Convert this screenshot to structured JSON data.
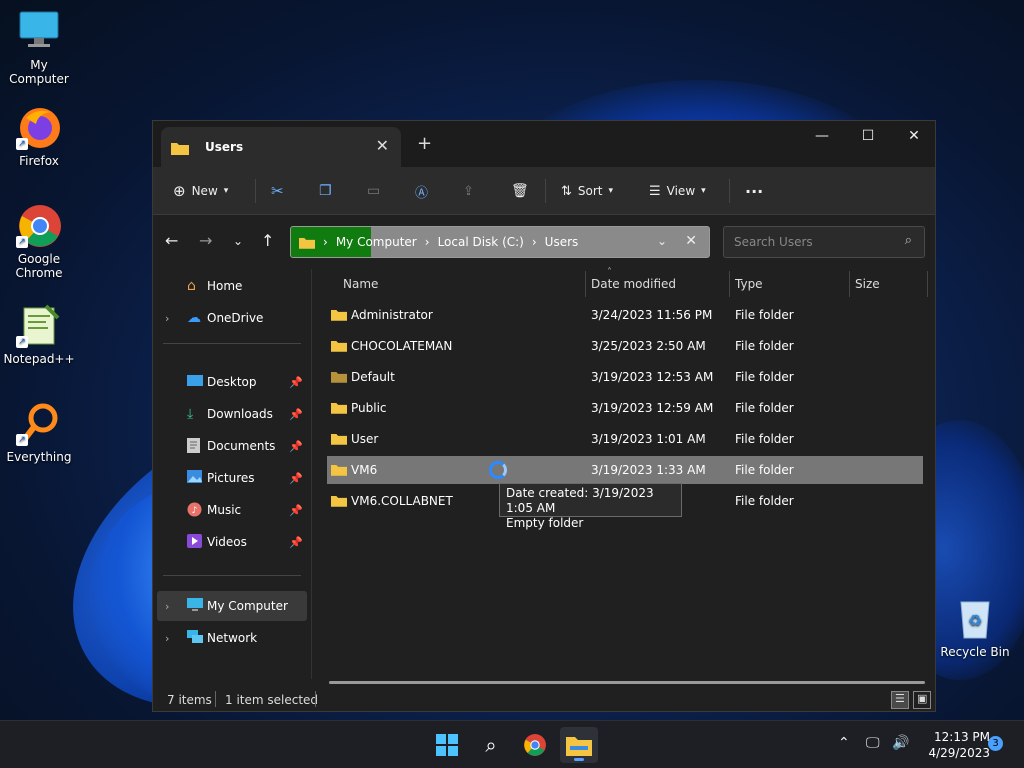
{
  "desktop": {
    "icons": [
      {
        "label": "My Computer",
        "icon": "monitor-icon"
      },
      {
        "label": "Firefox",
        "icon": "firefox-icon"
      },
      {
        "label": "Google Chrome",
        "icon": "chrome-icon"
      },
      {
        "label": "Notepad++",
        "icon": "notepadpp-icon"
      },
      {
        "label": "Everything",
        "icon": "everything-search-icon"
      }
    ],
    "recycle_bin": "Recycle Bin"
  },
  "window": {
    "tab_title": "Users",
    "toolbar": {
      "new_label": "New",
      "sort_label": "Sort",
      "view_label": "View",
      "more_label": "···"
    },
    "address": {
      "crumbs": [
        "My Computer",
        "Local Disk (C:)",
        "Users"
      ]
    },
    "search": {
      "placeholder": "Search Users"
    },
    "sidebar": {
      "home": "Home",
      "onedrive": "OneDrive",
      "quick": [
        "Desktop",
        "Downloads",
        "Documents",
        "Pictures",
        "Music",
        "Videos"
      ],
      "computer": "My Computer",
      "network": "Network"
    },
    "columns": {
      "name": "Name",
      "date": "Date modified",
      "type": "Type",
      "size": "Size"
    },
    "rows": [
      {
        "name": "Administrator",
        "date": "3/24/2023 11:56 PM",
        "type": "File folder"
      },
      {
        "name": "CHOCOLATEMAN",
        "date": "3/25/2023 2:50 AM",
        "type": "File folder"
      },
      {
        "name": "Default",
        "date": "3/19/2023 12:53 AM",
        "type": "File folder"
      },
      {
        "name": "Public",
        "date": "3/19/2023 12:59 AM",
        "type": "File folder"
      },
      {
        "name": "User",
        "date": "3/19/2023 1:01 AM",
        "type": "File folder"
      },
      {
        "name": "VM6",
        "date": "3/19/2023 1:33 AM",
        "type": "File folder"
      },
      {
        "name": "VM6.COLLABNET",
        "date": "",
        "type": "File folder"
      }
    ],
    "tooltip": {
      "line1": "Date created: 3/19/2023 1:05 AM",
      "line2": "Empty folder"
    },
    "status": {
      "items": "7 items",
      "selected": "1 item selected"
    }
  },
  "taskbar": {
    "time": "12:13 PM",
    "date": "4/29/2023",
    "notifications": "3"
  },
  "colors": {
    "accent": "#107c10",
    "selection": "#777777",
    "folder": "#f4c542"
  }
}
